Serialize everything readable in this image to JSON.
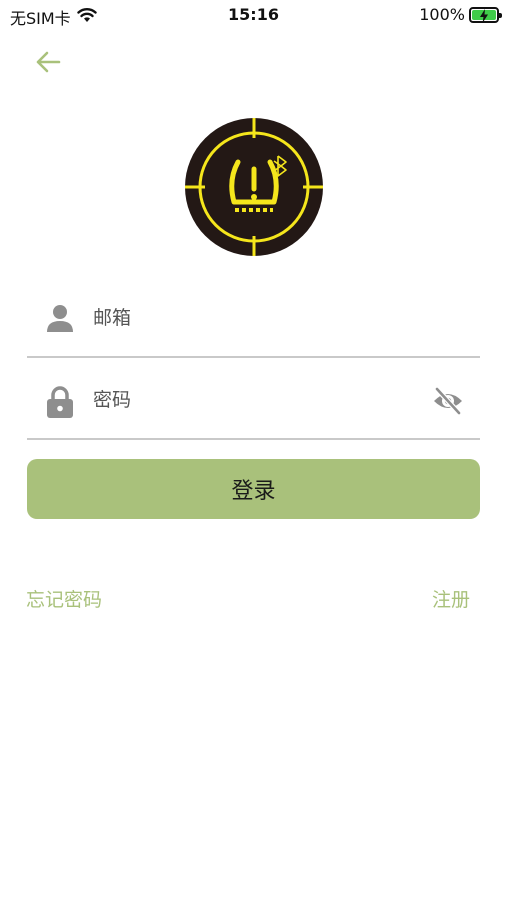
{
  "status_bar": {
    "carrier": "无SIM卡",
    "time": "15:16",
    "battery_percent": "100%",
    "battery_level": 1.0,
    "icons": [
      "wifi-icon",
      "battery-charging-icon"
    ]
  },
  "header": {
    "back_icon": "arrow-left-icon"
  },
  "logo": {
    "icon": "tire-pressure-warning-bluetooth-icon",
    "colors": {
      "background": "#231815",
      "accent": "#f5e61c"
    }
  },
  "form": {
    "email": {
      "placeholder": "邮箱",
      "value": "",
      "icon": "user-icon"
    },
    "password": {
      "placeholder": "密码",
      "value": "",
      "icon": "lock-icon",
      "toggle_icon": "eye-off-icon"
    },
    "submit_label": "登录"
  },
  "links": {
    "forgot_password": "忘记密码",
    "register": "注册"
  },
  "colors": {
    "accent": "#a9c17b",
    "icon_gray": "#8e8e8e",
    "divider": "#c9c9c9"
  }
}
